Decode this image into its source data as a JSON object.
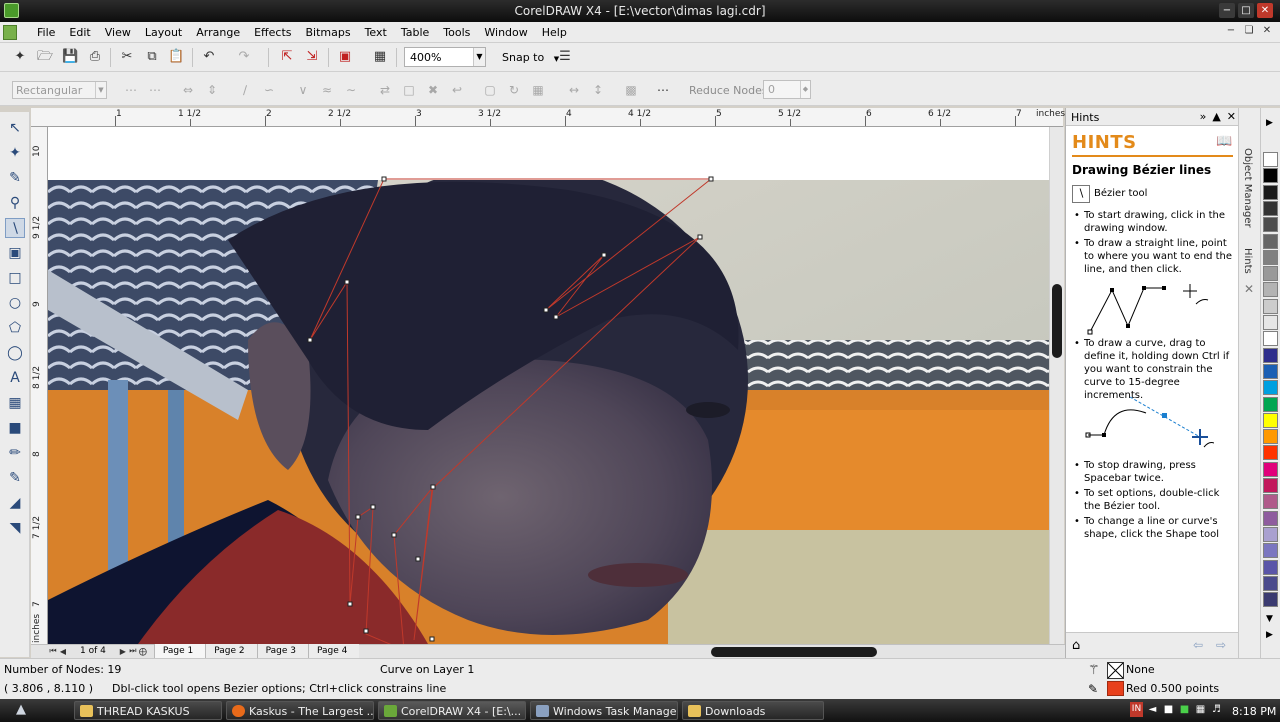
{
  "window": {
    "title": "CorelDRAW X4 - [E:\\vector\\dimas lagi.cdr]",
    "min_glyph": "−",
    "max_glyph": "□",
    "close_glyph": "✕"
  },
  "menu": [
    "File",
    "Edit",
    "View",
    "Layout",
    "Arrange",
    "Effects",
    "Bitmaps",
    "Text",
    "Table",
    "Tools",
    "Window",
    "Help"
  ],
  "toolbar": {
    "zoom_value": "400%",
    "snap_label": "Snap to"
  },
  "propbar": {
    "shape_mode": "Rectangular",
    "reduce_nodes_label": "Reduce Nodes",
    "reduce_nodes_value": "0"
  },
  "ruler": {
    "units": "inches",
    "h_labels": [
      "1",
      "1 1/2",
      "2",
      "2 1/2",
      "3",
      "3 1/2",
      "4",
      "4 1/2",
      "5",
      "5 1/2",
      "6",
      "6 1/2",
      "7"
    ],
    "v_labels": [
      "10",
      "9 1/2",
      "9",
      "8 1/2",
      "8",
      "7 1/2",
      "7"
    ],
    "v_units": "inches"
  },
  "pages": {
    "count_text": "1 of 4",
    "tabs": [
      "Page 1",
      "Page 2",
      "Page 3",
      "Page 4"
    ]
  },
  "docker": {
    "title": "Hints",
    "banner": "HINTS",
    "heading": "Drawing Bézier lines",
    "tool_name": "Bézier tool",
    "hints": [
      "To start drawing, click in the drawing window.",
      "To draw a straight line, point to where you want to end the line, and then click.",
      "To draw a curve, drag to define it, holding down Ctrl if you want to constrain the curve to 15-degree increments.",
      "To stop drawing, press Spacebar twice.",
      "To set options, double-click the Bézier tool.",
      "To change a line or curve's shape, click the Shape tool"
    ],
    "side_tabs": [
      "Object Manager",
      "Hints"
    ]
  },
  "palette_colors": [
    "#ffffff",
    "#000000",
    "#1a1a1a",
    "#333333",
    "#4d4d4d",
    "#666666",
    "#808080",
    "#999999",
    "#b3b3b3",
    "#cccccc",
    "#e6e6e6",
    "#ffffff",
    "#2e2e8c",
    "#1a5fb4",
    "#00a0e0",
    "#00a651",
    "#ffff00",
    "#ff9900",
    "#ff3300",
    "#e0007a",
    "#c2185b",
    "#b05a8a",
    "#8e5c9e",
    "#a9a0d0",
    "#7b76c0",
    "#5a55a8",
    "#4a4a8c",
    "#3a3a70"
  ],
  "status": {
    "nodes": "Number of Nodes: 19",
    "object": "Curve on Layer 1",
    "coords": "( 3.806 , 8.110 )",
    "hint": "Dbl-click tool opens Bezier options; Ctrl+click constrains line",
    "fill": "None",
    "outline": "Red  0.500 points"
  },
  "taskbar": {
    "tasks": [
      "THREAD KASKUS",
      "Kaskus - The Largest ...",
      "CorelDRAW X4 - [E:\\...",
      "Windows Task Manager",
      "Downloads"
    ],
    "lang": "IN",
    "clock": "8:18 PM"
  }
}
